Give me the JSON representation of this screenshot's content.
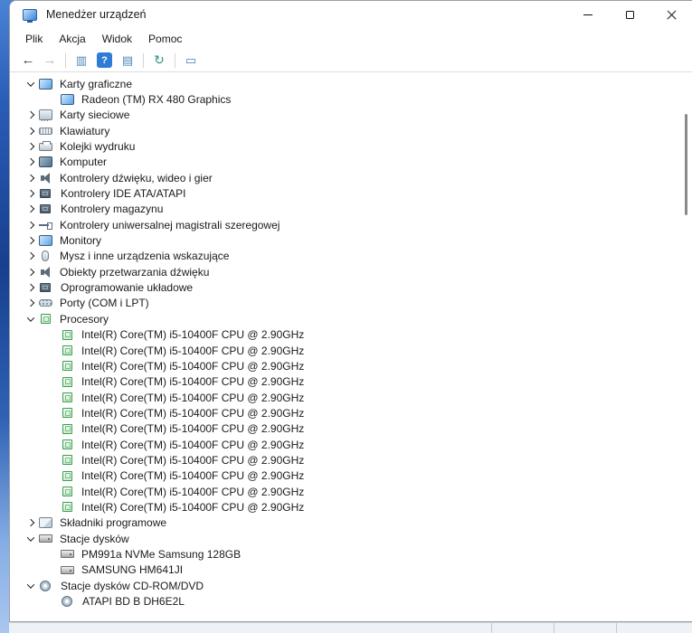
{
  "window": {
    "title": "Menedżer urządzeń"
  },
  "menu": {
    "items": [
      "Plik",
      "Akcja",
      "Widok",
      "Pomoc"
    ]
  },
  "toolbar": {
    "items": [
      {
        "type": "button",
        "name": "back",
        "glyph": "←"
      },
      {
        "type": "button",
        "name": "forward",
        "glyph": "→"
      },
      {
        "type": "separator"
      },
      {
        "type": "button",
        "name": "console-tree",
        "glyph": "▥"
      },
      {
        "type": "button",
        "name": "help",
        "glyph": "?"
      },
      {
        "type": "button",
        "name": "properties",
        "glyph": "▤"
      },
      {
        "type": "separator"
      },
      {
        "type": "button",
        "name": "refresh",
        "glyph": "↻"
      },
      {
        "type": "separator"
      },
      {
        "type": "button",
        "name": "scan-hardware",
        "glyph": "▭"
      }
    ]
  },
  "colors": {
    "accent": "#2f7cd6",
    "processor_icon_green": "#3a9e4d",
    "wallpaper_blue": "#173f8f"
  },
  "tree": {
    "items": [
      {
        "label": "Karty graficzne",
        "level": 0,
        "expand": "open",
        "icon": "display-adapter"
      },
      {
        "label": "Radeon (TM) RX 480 Graphics",
        "level": 1,
        "expand": "none",
        "icon": "display-adapter"
      },
      {
        "label": "Karty sieciowe",
        "level": 0,
        "expand": "closed",
        "icon": "network-adapter"
      },
      {
        "label": "Klawiatury",
        "level": 0,
        "expand": "closed",
        "icon": "keyboard"
      },
      {
        "label": "Kolejki wydruku",
        "level": 0,
        "expand": "closed",
        "icon": "print-queue"
      },
      {
        "label": "Komputer",
        "level": 0,
        "expand": "closed",
        "icon": "computer"
      },
      {
        "label": "Kontrolery dźwięku, wideo i gier",
        "level": 0,
        "expand": "closed",
        "icon": "sound-controller"
      },
      {
        "label": "Kontrolery IDE ATA/ATAPI",
        "level": 0,
        "expand": "closed",
        "icon": "ide-controller"
      },
      {
        "label": "Kontrolery magazynu",
        "level": 0,
        "expand": "closed",
        "icon": "storage-controller"
      },
      {
        "label": "Kontrolery uniwersalnej magistrali szeregowej",
        "level": 0,
        "expand": "closed",
        "icon": "usb-controller"
      },
      {
        "label": "Monitory",
        "level": 0,
        "expand": "closed",
        "icon": "monitor"
      },
      {
        "label": "Mysz i inne urządzenia wskazujące",
        "level": 0,
        "expand": "closed",
        "icon": "mouse"
      },
      {
        "label": "Obiekty przetwarzania dźwięku",
        "level": 0,
        "expand": "closed",
        "icon": "audio-object"
      },
      {
        "label": "Oprogramowanie układowe",
        "level": 0,
        "expand": "closed",
        "icon": "firmware"
      },
      {
        "label": "Porty (COM i LPT)",
        "level": 0,
        "expand": "closed",
        "icon": "ports"
      },
      {
        "label": "Procesory",
        "level": 0,
        "expand": "open",
        "icon": "processor"
      },
      {
        "label": "Intel(R) Core(TM) i5-10400F CPU @ 2.90GHz",
        "level": 1,
        "expand": "none",
        "icon": "processor"
      },
      {
        "label": "Intel(R) Core(TM) i5-10400F CPU @ 2.90GHz",
        "level": 1,
        "expand": "none",
        "icon": "processor"
      },
      {
        "label": "Intel(R) Core(TM) i5-10400F CPU @ 2.90GHz",
        "level": 1,
        "expand": "none",
        "icon": "processor"
      },
      {
        "label": "Intel(R) Core(TM) i5-10400F CPU @ 2.90GHz",
        "level": 1,
        "expand": "none",
        "icon": "processor"
      },
      {
        "label": "Intel(R) Core(TM) i5-10400F CPU @ 2.90GHz",
        "level": 1,
        "expand": "none",
        "icon": "processor"
      },
      {
        "label": "Intel(R) Core(TM) i5-10400F CPU @ 2.90GHz",
        "level": 1,
        "expand": "none",
        "icon": "processor"
      },
      {
        "label": "Intel(R) Core(TM) i5-10400F CPU @ 2.90GHz",
        "level": 1,
        "expand": "none",
        "icon": "processor"
      },
      {
        "label": "Intel(R) Core(TM) i5-10400F CPU @ 2.90GHz",
        "level": 1,
        "expand": "none",
        "icon": "processor"
      },
      {
        "label": "Intel(R) Core(TM) i5-10400F CPU @ 2.90GHz",
        "level": 1,
        "expand": "none",
        "icon": "processor"
      },
      {
        "label": "Intel(R) Core(TM) i5-10400F CPU @ 2.90GHz",
        "level": 1,
        "expand": "none",
        "icon": "processor"
      },
      {
        "label": "Intel(R) Core(TM) i5-10400F CPU @ 2.90GHz",
        "level": 1,
        "expand": "none",
        "icon": "processor"
      },
      {
        "label": "Intel(R) Core(TM) i5-10400F CPU @ 2.90GHz",
        "level": 1,
        "expand": "none",
        "icon": "processor"
      },
      {
        "label": "Składniki programowe",
        "level": 0,
        "expand": "closed",
        "icon": "software-component"
      },
      {
        "label": "Stacje dysków",
        "level": 0,
        "expand": "open",
        "icon": "disk-drive"
      },
      {
        "label": "PM991a NVMe Samsung 128GB",
        "level": 1,
        "expand": "none",
        "icon": "disk-drive"
      },
      {
        "label": "SAMSUNG HM641JI",
        "level": 1,
        "expand": "none",
        "icon": "disk-drive"
      },
      {
        "label": "Stacje dysków CD-ROM/DVD",
        "level": 0,
        "expand": "open",
        "icon": "cdrom"
      },
      {
        "label": "ATAPI BD B DH6E2L",
        "level": 1,
        "expand": "none",
        "icon": "cdrom"
      }
    ]
  }
}
